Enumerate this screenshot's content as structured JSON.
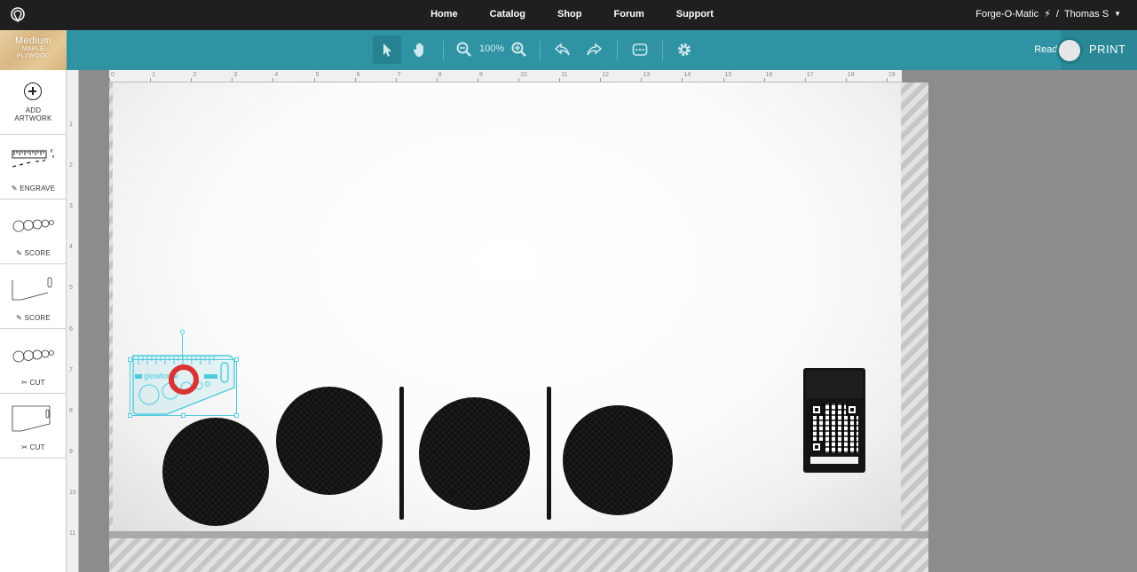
{
  "nav": {
    "links": [
      "Home",
      "Catalog",
      "Shop",
      "Forum",
      "Support"
    ],
    "machine": "Forge-O-Matic",
    "separator": "/",
    "user": "Thomas S"
  },
  "toolbar": {
    "zoom": "100%",
    "status": "Ready",
    "print_label": "PRINT"
  },
  "material": {
    "thickness": "Medium",
    "line1": "MAPLE",
    "line2": "PLYWOOD"
  },
  "sidebar": {
    "add_line1": "ADD",
    "add_line2": "ARTWORK",
    "steps": [
      {
        "label": "ENGRAVE",
        "icon": "pencil-icon"
      },
      {
        "label": "SCORE",
        "icon": "pencil-icon"
      },
      {
        "label": "SCORE",
        "icon": "pencil-icon"
      },
      {
        "label": "CUT",
        "icon": "cut-icon"
      },
      {
        "label": "CUT",
        "icon": "cut-icon"
      }
    ]
  },
  "ruler": {
    "top": [
      "0",
      "1",
      "2",
      "3",
      "4",
      "5",
      "6",
      "7",
      "8",
      "9",
      "10",
      "11",
      "12",
      "13",
      "14",
      "15",
      "16",
      "17",
      "18",
      "19"
    ],
    "left": [
      "1",
      "2",
      "3",
      "4",
      "5",
      "6",
      "7",
      "8",
      "9",
      "10",
      "11"
    ]
  },
  "artwork": {
    "text": "glowforge"
  },
  "colors": {
    "nav_bg": "#1f1f1f",
    "toolbar_bg": "#2f93a3",
    "selection": "#4ecbdd",
    "cursor": "#d93434"
  }
}
